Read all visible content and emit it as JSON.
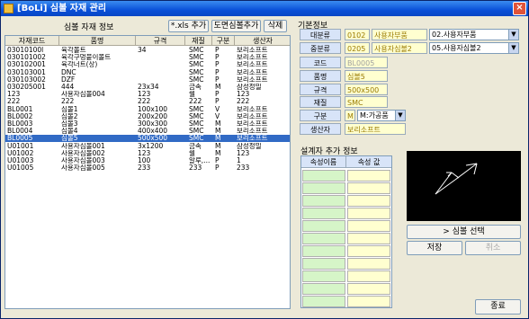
{
  "window": {
    "title": "[BoLi] 심볼 자재 관리",
    "close": "×"
  },
  "left": {
    "header": "심볼 자재 정보",
    "buttons": {
      "xls": "*.xls 추가",
      "drawing": "도면심볼추가",
      "delete": "삭제"
    },
    "columns": [
      "자재코드",
      "품명",
      "규격",
      "재질",
      "구분",
      "생산자"
    ],
    "rows": [
      [
        "03010100l",
        "육각볼트",
        "34",
        "SMC",
        "P",
        "보리소프트"
      ],
      [
        "030101002",
        "육각구멍붙이볼트",
        "",
        "SMC",
        "P",
        "보리소프트"
      ],
      [
        "030102001",
        "육각너트(상)",
        "",
        "SMC",
        "P",
        "보리소프트"
      ],
      [
        "030103001",
        "DNC",
        "",
        "SMC",
        "P",
        "보리소프트"
      ],
      [
        "030103002",
        "DZF",
        "",
        "SMC",
        "P",
        "보리소프트"
      ],
      [
        "030205001",
        "444",
        "23x34",
        "금속",
        "M",
        "삼성정밀"
      ],
      [
        "123",
        "사용자심볼004",
        "123",
        "쉘",
        "P",
        "123"
      ],
      [
        "222",
        "222",
        "222",
        "222",
        "P",
        "222"
      ],
      [
        "BL0001",
        "심볼1",
        "100x100",
        "SMC",
        "V",
        "보리소프트"
      ],
      [
        "BL0002",
        "심볼2",
        "200x200",
        "SMC",
        "V",
        "보리소프트"
      ],
      [
        "BL0003",
        "심볼3",
        "300x300",
        "SMC",
        "M",
        "보리소프트"
      ],
      [
        "BL0004",
        "심볼4",
        "400x400",
        "SMC",
        "M",
        "보리소프트"
      ],
      [
        "BL0005",
        "심볼5",
        "500x500",
        "SMC",
        "M",
        "보리소프트"
      ],
      [
        "U01001",
        "사용자심볼001",
        "3x1200",
        "금속",
        "M",
        "삼성정밀"
      ],
      [
        "U01002",
        "사용자심볼002",
        "123",
        "쉘",
        "M",
        "123"
      ],
      [
        "U01003",
        "사용자심볼003",
        "100",
        "알루,...",
        "P",
        "1"
      ],
      [
        "U01005",
        "사용자심볼005",
        "233",
        "233",
        "P",
        "233"
      ]
    ],
    "selected_row": 12
  },
  "right": {
    "basic_header": "기본정보",
    "large_label": "대분류",
    "large_code": "0102",
    "large_name": "사용자부품",
    "large_combo": "02.사용자부품",
    "mid_label": "중분류",
    "mid_code": "0205",
    "mid_name": "사용자심볼2",
    "mid_combo": "05.사용자심볼2",
    "code_label": "코드",
    "code_value": "BL0005",
    "name_label": "품명",
    "name_value": "심볼5",
    "spec_label": "규격",
    "spec_value": "500x500",
    "material_label": "재질",
    "material_value": "SMC",
    "type_label": "구분",
    "type_code": "M",
    "type_combo": "M:가공품",
    "maker_label": "생산자",
    "maker_value": "보리소프트",
    "attr_header": "설계자 추가 정보",
    "attr_col1": "속성이름",
    "attr_col2": "속성 값",
    "select_symbol": "> 심볼 선택",
    "save": "저장",
    "cancel": "취소",
    "exit": "종료"
  },
  "colors": {
    "title": "#0a50d8",
    "selection": "#316ac5",
    "field_bg": "#ffffd0",
    "label_bg": "#d8e4f8"
  }
}
